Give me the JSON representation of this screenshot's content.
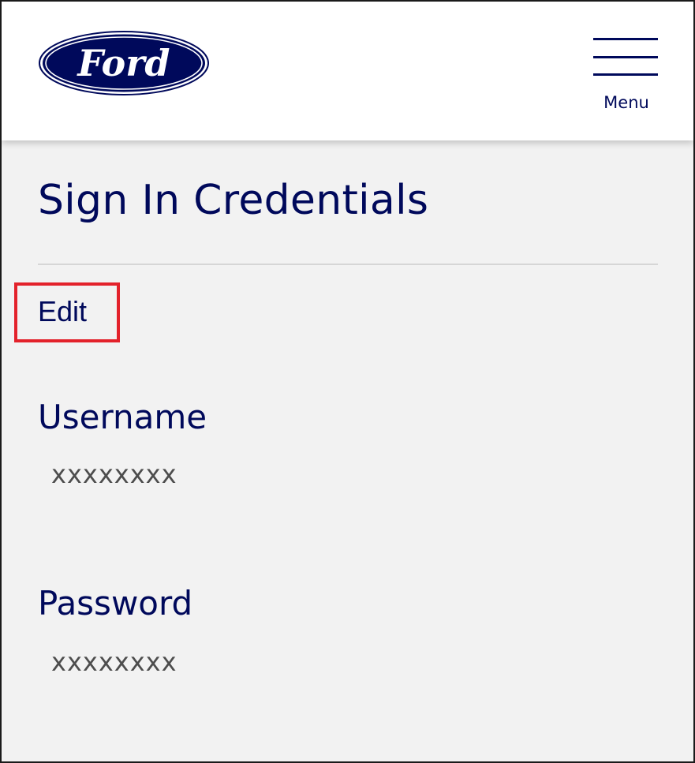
{
  "header": {
    "logo_text": "Ford",
    "menu_label": "Menu"
  },
  "page": {
    "title": "Sign In Credentials",
    "edit_label": "Edit"
  },
  "fields": {
    "username": {
      "label": "Username",
      "value": "xxxxxxxx"
    },
    "password": {
      "label": "Password",
      "value": "xxxxxxxx"
    }
  },
  "colors": {
    "brand_navy": "#00095b",
    "highlight_red": "#e3222b",
    "background": "#f2f2f2",
    "value_text": "#4d4d4d"
  },
  "icons": {
    "logo": "ford-oval-logo",
    "menu": "hamburger-menu-icon"
  }
}
